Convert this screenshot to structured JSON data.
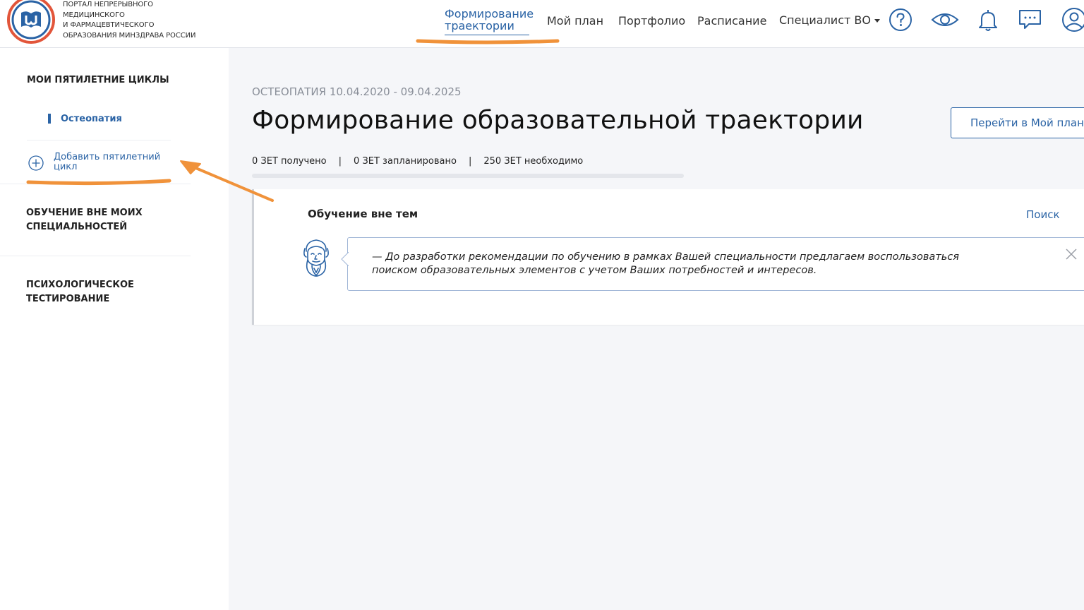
{
  "header": {
    "logo_lines": [
      "Портал непрерывного",
      "медицинского",
      "и фармацевтического",
      "образования минздрава России"
    ],
    "nav": {
      "active": "Формирование траектории",
      "items": [
        "Мой план",
        "Портфолио",
        "Расписание"
      ],
      "role": "Специалист ВО"
    },
    "icons": [
      "help-icon",
      "eye-icon",
      "bell-icon",
      "chat-icon",
      "user-icon"
    ]
  },
  "sidebar": {
    "cycles_heading": "МОИ ПЯТИЛЕТНИЕ ЦИКЛЫ",
    "cycle_item": "Остеопатия",
    "add_cycle": "Добавить пятилетний цикл",
    "outside_heading": "ОБУЧЕНИЕ ВНЕ МОИХ СПЕЦИАЛЬНОСТЕЙ",
    "psych_heading": "ПСИХОЛОГИЧЕСКОЕ ТЕСТИРОВАНИЕ"
  },
  "main": {
    "subtitle": "ОСТЕОПАТИЯ 10.04.2020 - 09.04.2025",
    "title": "Формирование образовательной траектории",
    "plan_button": "Перейти в Мой план",
    "stats": {
      "received": "0 ЗЕТ получено",
      "planned": "0 ЗЕТ запланировано",
      "needed": "250 ЗЕТ необходимо",
      "separator": "|"
    },
    "progress_fraction": 0,
    "card": {
      "title": "Обучение вне тем",
      "search": "Поиск",
      "message": "— До разработки рекомендации по обучению в рамках Вашей специальности предлагаем воспользоваться поиском образовательных элементов с учетом Ваших потребностей и интересов."
    }
  },
  "colors": {
    "accent": "#2a63a5",
    "annotation": "#f0923a",
    "logo_ring": "#e2553a",
    "background": "#f5f6f9"
  }
}
